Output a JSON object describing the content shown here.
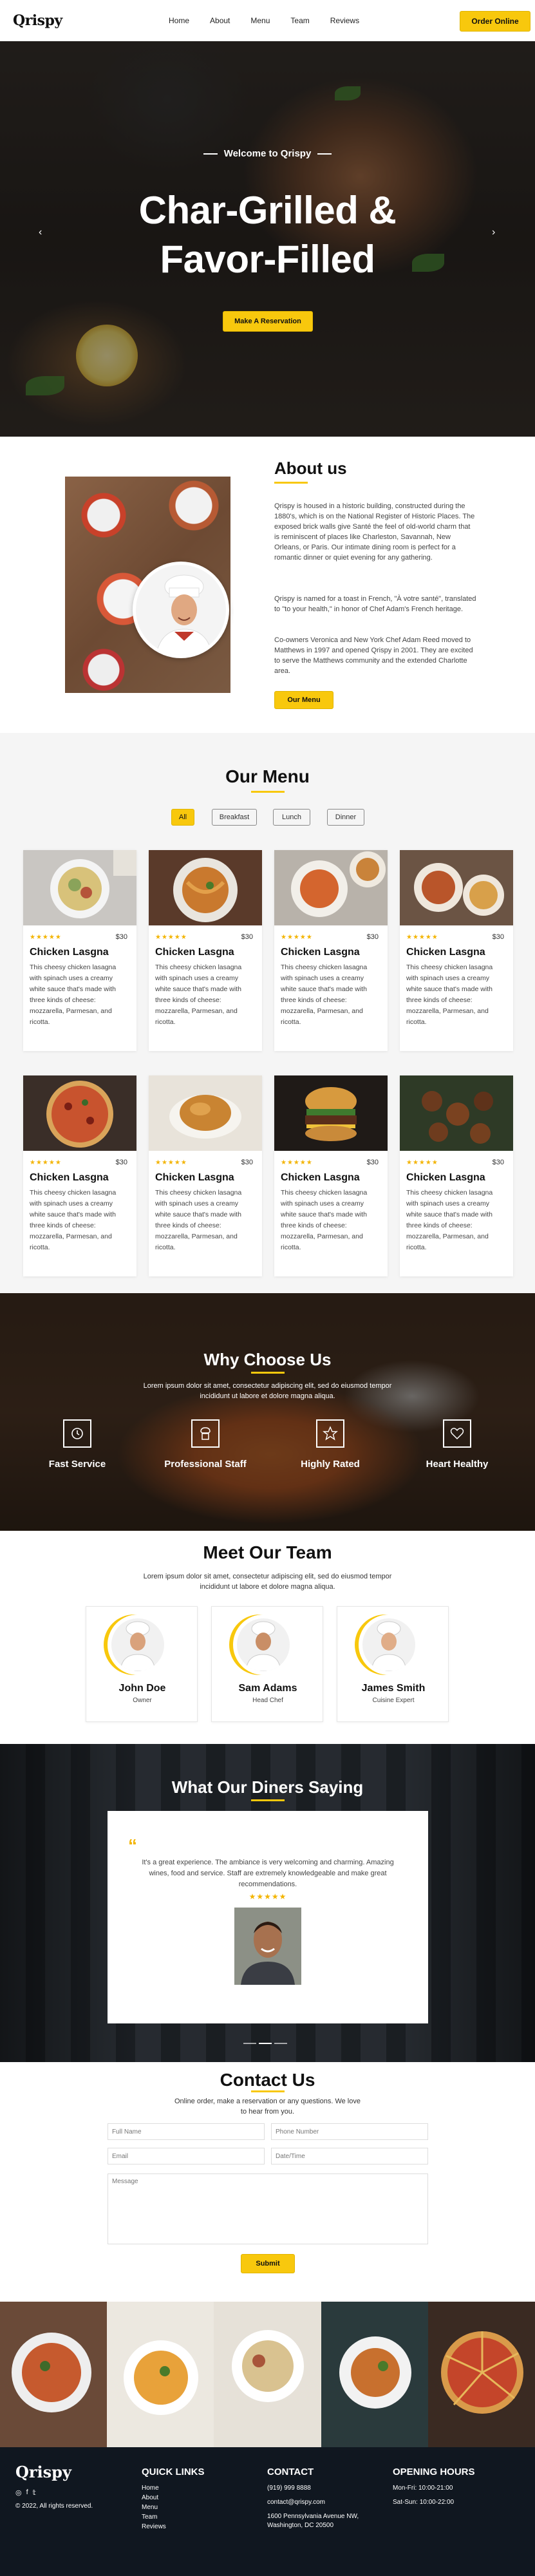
{
  "brand": "Qrispy",
  "nav": {
    "links": [
      "Home",
      "About",
      "Menu",
      "Team",
      "Reviews"
    ],
    "order_label": "Order Online"
  },
  "hero": {
    "welcome": "Welcome to Qrispy",
    "title_line1": "Char-Grilled &",
    "title_line2": "Favor-Filled",
    "button": "Make A Reservation",
    "prev_icon": "‹",
    "next_icon": "›"
  },
  "about": {
    "title": "About us",
    "p1": "Qrispy is housed in a historic building, constructed during the 1880's, which is on the National Register of Historic Places. The exposed brick walls give Santé the feel of old-world charm that is reminiscent of places like Charleston, Savannah, New Orleans, or Paris. Our intimate dining room is perfect for a romantic dinner or quiet evening for any gathering.",
    "p2": "Qrispy is named for a toast in French, \"À votre santé\", translated to \"to your health,\" in honor of Chef Adam's French heritage.",
    "p3": "Co-owners Veronica and New York Chef Adam Reed moved to Matthews in 1997 and opened Qrispy in 2001. They are excited to serve the Matthews community and the extended Charlotte area.",
    "button": "Our Menu"
  },
  "menu": {
    "title": "Our Menu",
    "filters": [
      "All",
      "Breakfast",
      "Lunch",
      "Dinner"
    ],
    "active_filter": "All",
    "items": [
      {
        "name": "Chicken Lasgna",
        "price": "$30",
        "stars": "★★★★★",
        "desc": "This cheesy chicken lasagna with spinach uses a creamy white sauce that's made with three kinds of cheese: mozzarella, Parmesan, and ricotta."
      },
      {
        "name": "Chicken Lasgna",
        "price": "$30",
        "stars": "★★★★★",
        "desc": "This cheesy chicken lasagna with spinach uses a creamy white sauce that's made with three kinds of cheese: mozzarella, Parmesan, and ricotta."
      },
      {
        "name": "Chicken Lasgna",
        "price": "$30",
        "stars": "★★★★★",
        "desc": "This cheesy chicken lasagna with spinach uses a creamy white sauce that's made with three kinds of cheese: mozzarella, Parmesan, and ricotta."
      },
      {
        "name": "Chicken Lasgna",
        "price": "$30",
        "stars": "★★★★★",
        "desc": "This cheesy chicken lasagna with spinach uses a creamy white sauce that's made with three kinds of cheese: mozzarella, Parmesan, and ricotta."
      },
      {
        "name": "Chicken Lasgna",
        "price": "$30",
        "stars": "★★★★★",
        "desc": "This cheesy chicken lasagna with spinach uses a creamy white sauce that's made with three kinds of cheese: mozzarella, Parmesan, and ricotta."
      },
      {
        "name": "Chicken Lasgna",
        "price": "$30",
        "stars": "★★★★★",
        "desc": "This cheesy chicken lasagna with spinach uses a creamy white sauce that's made with three kinds of cheese: mozzarella, Parmesan, and ricotta."
      },
      {
        "name": "Chicken Lasgna",
        "price": "$30",
        "stars": "★★★★★",
        "desc": "This cheesy chicken lasagna with spinach uses a creamy white sauce that's made with three kinds of cheese: mozzarella, Parmesan, and ricotta."
      },
      {
        "name": "Chicken Lasgna",
        "price": "$30",
        "stars": "★★★★★",
        "desc": "This cheesy chicken lasagna with spinach uses a creamy white sauce that's made with three kinds of cheese: mozzarella, Parmesan, and ricotta."
      }
    ]
  },
  "why": {
    "title": "Why Choose Us",
    "subtitle": "Lorem ipsum dolor sit amet, consectetur adipiscing elit, sed do eiusmod tempor incididunt ut labore et dolore magna aliqua.",
    "features": [
      {
        "label": "Fast Service",
        "icon": "clock-icon"
      },
      {
        "label": "Professional Staff",
        "icon": "chef-icon"
      },
      {
        "label": "Highly Rated",
        "icon": "star-icon"
      },
      {
        "label": "Heart Healthy",
        "icon": "heart-icon"
      }
    ]
  },
  "team": {
    "title": "Meet Our Team",
    "subtitle": "Lorem ipsum dolor sit amet, consectetur adipiscing elit, sed do eiusmod tempor incididunt ut labore et dolore magna aliqua.",
    "members": [
      {
        "name": "John Doe",
        "role": "Owner"
      },
      {
        "name": "Sam Adams",
        "role": "Head Chef"
      },
      {
        "name": "James Smith",
        "role": "Cuisine Expert"
      }
    ]
  },
  "reviews": {
    "title": "What Our Diners Saying",
    "quote_mark": "“",
    "text": "It's a great experience. The ambiance is very welcoming and charming. Amazing wines, food and service. Staff are extremely knowledgeable and make great recommendations.",
    "stars": "★★★★★"
  },
  "contact": {
    "title": "Contact Us",
    "subtitle": "Online order, make a reservation or any questions. We love to hear from you.",
    "fields": {
      "full_name": "Full Name",
      "phone": "Phone Number",
      "email": "Email",
      "datetime": "Date/Time",
      "message": "Message"
    },
    "submit": "Submit"
  },
  "footer": {
    "brand": "Qrispy",
    "copyright": "© 2022, All rights reserved.",
    "social_icons": [
      "instagram-icon",
      "facebook-icon",
      "twitter-icon"
    ],
    "quick_links_title": "QUICK LINKS",
    "quick_links": [
      "Home",
      "About",
      "Menu",
      "Team",
      "Reviews"
    ],
    "contact_title": "CONTACT",
    "phone": "(919) 999 8888",
    "email": "contact@qrispy.com",
    "address_line1": "1600 Pennsylvania Avenue NW,",
    "address_line2": "Washington, DC 20500",
    "hours_title": "OPENING HOURS",
    "hours_weekday": "Mon-Fri: 10:00-21:00",
    "hours_weekend": "Sat-Sun: 10:00-22:00"
  },
  "colors": {
    "accent": "#f8c80d",
    "footer_bg": "#101720",
    "star": "#f3b400"
  }
}
